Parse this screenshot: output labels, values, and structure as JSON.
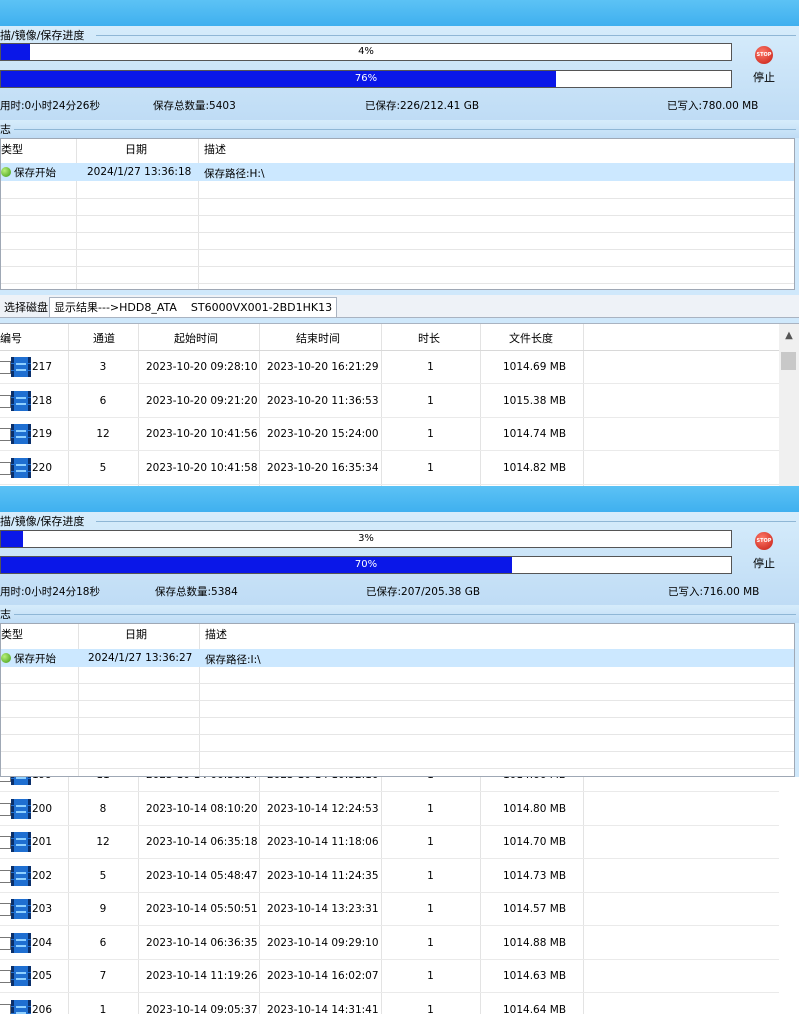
{
  "panel1": {
    "group_label": "描/镜像/保存进度",
    "bar1": {
      "text": "4%",
      "fraction": 0.04
    },
    "bar2": {
      "text": "76%",
      "fraction": 0.76
    },
    "stop_label": "停止",
    "stop_icon_text": "STOP",
    "elapsed": "用时:0小时24分26秒",
    "total": "保存总数量:5403",
    "saved": "已保存:226/212.41 GB",
    "written": "已写入:780.00 MB",
    "log_label": "志",
    "log": {
      "headers": [
        "类型",
        "日期",
        "描述"
      ],
      "rows": [
        {
          "type": "保存开始",
          "date": "2024/1/27 13:36:18",
          "desc": "保存路径:H:\\"
        }
      ]
    }
  },
  "tabs": {
    "select_disk": "选择磁盘",
    "result": "显示结果--->HDD8_ATA",
    "model": "ST6000VX001-2BD1HK13"
  },
  "list1": {
    "headers": [
      "编号",
      "通道",
      "起始时间",
      "结束时间",
      "时长",
      "文件长度"
    ],
    "rows": [
      {
        "id": "217",
        "ch": "3",
        "start": "2023-10-20 09:28:10",
        "end": "2023-10-20 16:21:29",
        "dur": "1",
        "size": "1014.69 MB"
      },
      {
        "id": "218",
        "ch": "6",
        "start": "2023-10-20 09:21:20",
        "end": "2023-10-20 11:36:53",
        "dur": "1",
        "size": "1015.38 MB"
      },
      {
        "id": "219",
        "ch": "12",
        "start": "2023-10-20 10:41:56",
        "end": "2023-10-20 15:24:00",
        "dur": "1",
        "size": "1014.74 MB"
      },
      {
        "id": "220",
        "ch": "5",
        "start": "2023-10-20 10:41:58",
        "end": "2023-10-20 16:35:34",
        "dur": "1",
        "size": "1014.82 MB"
      }
    ]
  },
  "panel2": {
    "group_label": "描/镜像/保存进度",
    "bar1": {
      "text": "3%",
      "fraction": 0.03
    },
    "bar2": {
      "text": "70%",
      "fraction": 0.7
    },
    "stop_label": "停止",
    "stop_icon_text": "STOP",
    "elapsed": "用时:0小时24分18秒",
    "total": "保存总数量:5384",
    "saved": "已保存:207/205.38 GB",
    "written": "已写入:716.00 MB",
    "log_label": "志",
    "log": {
      "headers": [
        "类型",
        "日期",
        "描述"
      ],
      "rows": [
        {
          "type": "保存开始",
          "date": "2024/1/27 13:36:27",
          "desc": "保存路径:I:\\"
        }
      ]
    }
  },
  "list2": {
    "rows": [
      {
        "id": "199",
        "ch": "11",
        "start": "2023-10-14 06:38:14",
        "end": "2023-10-14 10:52:10",
        "dur": "1",
        "size": "1014.66 MB"
      },
      {
        "id": "200",
        "ch": "8",
        "start": "2023-10-14 08:10:20",
        "end": "2023-10-14 12:24:53",
        "dur": "1",
        "size": "1014.80 MB"
      },
      {
        "id": "201",
        "ch": "12",
        "start": "2023-10-14 06:35:18",
        "end": "2023-10-14 11:18:06",
        "dur": "1",
        "size": "1014.70 MB"
      },
      {
        "id": "202",
        "ch": "5",
        "start": "2023-10-14 05:48:47",
        "end": "2023-10-14 11:24:35",
        "dur": "1",
        "size": "1014.73 MB"
      },
      {
        "id": "203",
        "ch": "9",
        "start": "2023-10-14 05:50:51",
        "end": "2023-10-14 13:23:31",
        "dur": "1",
        "size": "1014.57 MB"
      },
      {
        "id": "204",
        "ch": "6",
        "start": "2023-10-14 06:36:35",
        "end": "2023-10-14 09:29:10",
        "dur": "1",
        "size": "1014.88 MB"
      },
      {
        "id": "205",
        "ch": "7",
        "start": "2023-10-14 11:19:26",
        "end": "2023-10-14 16:02:07",
        "dur": "1",
        "size": "1014.63 MB"
      },
      {
        "id": "206",
        "ch": "1",
        "start": "2023-10-14 09:05:37",
        "end": "2023-10-14 14:31:41",
        "dur": "1",
        "size": "1014.64 MB"
      }
    ]
  },
  "colors": {
    "progress_fill": "#0a17e8",
    "title_band": "#4db8f2",
    "selected_row": "#cce8ff"
  },
  "icons": [
    "stop-icon",
    "status-dot-icon",
    "video-file-icon",
    "scroll-up-icon"
  ]
}
